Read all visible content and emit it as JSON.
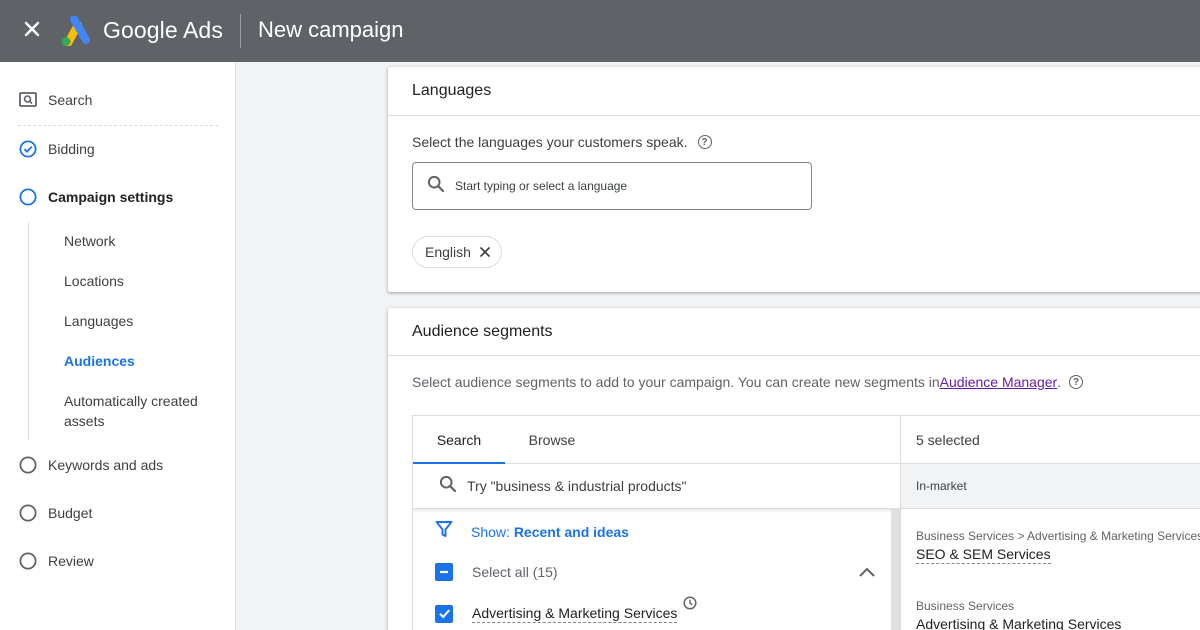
{
  "header": {
    "close_icon": "close-icon",
    "brand": "Google Ads",
    "title": "New campaign",
    "logo_colors": [
      "#fbbc04",
      "#4285f4",
      "#34a853"
    ]
  },
  "sidebar": {
    "steps": [
      {
        "label": "Search",
        "icon": "search-campaign-icon",
        "state": "done"
      },
      {
        "label": "Bidding",
        "icon": "check-circle-icon",
        "state": "done"
      },
      {
        "label": "Campaign settings",
        "icon": "circle-icon",
        "state": "active"
      },
      {
        "label": "Keywords and ads",
        "icon": "circle-icon",
        "state": "todo"
      },
      {
        "label": "Budget",
        "icon": "circle-icon",
        "state": "todo"
      },
      {
        "label": "Review",
        "icon": "circle-icon",
        "state": "todo"
      }
    ],
    "sub_items": [
      {
        "label": "Network"
      },
      {
        "label": "Locations"
      },
      {
        "label": "Languages"
      },
      {
        "label": "Audiences",
        "current": true
      },
      {
        "label": "Automatically created assets"
      }
    ]
  },
  "languages": {
    "title": "Languages",
    "prompt": "Select the languages your customers speak.",
    "input_placeholder": "Start typing or select a language",
    "chips": [
      "English"
    ]
  },
  "audiences": {
    "title": "Audience segments",
    "description": "Select audience segments to add to your campaign. You can create new segments in ",
    "link": "Audience Manager",
    "description_end": ".",
    "tabs": [
      "Search",
      "Browse"
    ],
    "active_tab": "Search",
    "search_placeholder": "Try \"business & industrial products\"",
    "show_prefix": "Show: ",
    "show_value": "Recent and ideas",
    "select_all": "Select all (15)",
    "items": [
      {
        "label": "Advertising & Marketing Services",
        "checked": true
      }
    ],
    "selected_count": "5 selected",
    "selected_category": "In-market",
    "selected": [
      {
        "path": "Business Services > Advertising & Marketing Services",
        "name": "SEO & SEM Services"
      },
      {
        "path": "Business Services",
        "name": "Advertising & Marketing Services"
      }
    ]
  },
  "colors": {
    "accent": "#1a73e8",
    "topbar": "#5f6368",
    "link": "#681da8"
  }
}
